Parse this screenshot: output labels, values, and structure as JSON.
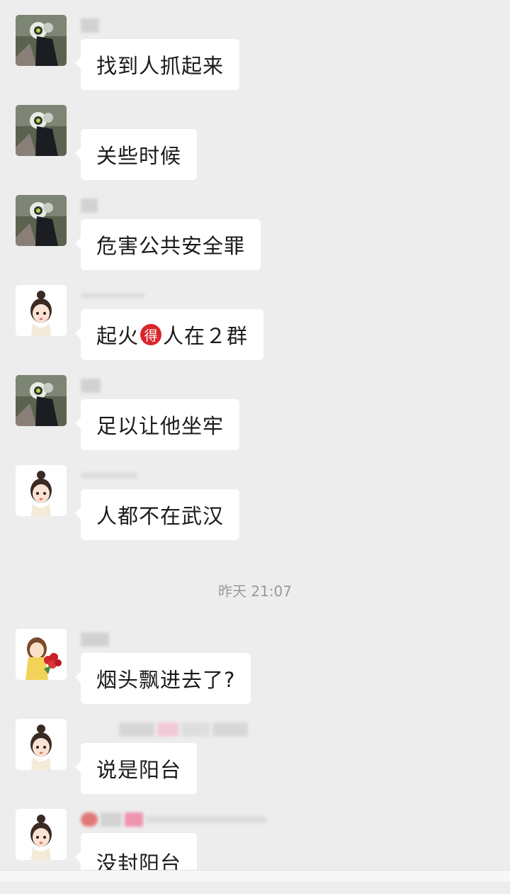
{
  "chat": {
    "timestamp": "昨天 21:07",
    "messages": [
      {
        "avatar": "motorcycle-avatar-icon",
        "sender": "",
        "text": "找到人抓起来"
      },
      {
        "avatar": "motorcycle-avatar-icon",
        "sender": "",
        "text": "关些时候"
      },
      {
        "avatar": "motorcycle-avatar-icon",
        "sender": "",
        "text": "危害公共安全罪"
      },
      {
        "avatar": "girl-avatar-icon",
        "sender": "",
        "text_before": "起火",
        "emoji": "得",
        "text_after": "人在２群"
      },
      {
        "avatar": "motorcycle-avatar-icon",
        "sender": "",
        "text": "足以让他坐牢"
      },
      {
        "avatar": "girl-avatar-icon",
        "sender": "",
        "text": "人都不在武汉"
      },
      {
        "avatar": "flower-girl-avatar-icon",
        "sender": "",
        "text": "烟头飘进去了?"
      },
      {
        "avatar": "girl-avatar-icon",
        "sender": "",
        "text": "说是阳台"
      },
      {
        "avatar": "girl-avatar-icon",
        "sender": "",
        "text": "没封阳台"
      }
    ]
  },
  "colors": {
    "background": "#ededed",
    "bubble": "#ffffff",
    "timestamp_text": "#9a9a9a",
    "emoji_badge": "#d9262c"
  }
}
